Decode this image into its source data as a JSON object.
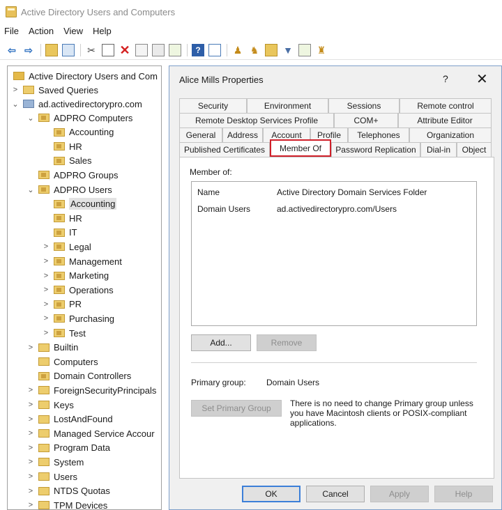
{
  "window": {
    "title": "Active Directory Users and Computers"
  },
  "menu": [
    "File",
    "Action",
    "View",
    "Help"
  ],
  "toolbar": {
    "icons": [
      "back-arrow-icon",
      "forward-arrow-icon",
      "up-folder-icon",
      "console-tree-icon",
      "cut-icon",
      "copy-icon",
      "delete-icon",
      "properties-icon",
      "refresh-icon",
      "export-list-icon",
      "help-icon",
      "mmc-icon",
      "create-user-icon",
      "create-group-icon",
      "create-ou-icon",
      "filter-icon",
      "find-icon",
      "add-to-group-icon"
    ]
  },
  "tree": {
    "root": "Active Directory Users and Com",
    "saved_queries": "Saved Queries",
    "domain": "ad.activedirectorypro.com",
    "nodes": [
      {
        "label": "ADPRO Computers",
        "level": 2,
        "expand": "open",
        "type": "ou"
      },
      {
        "label": "Accounting",
        "level": 3,
        "expand": "none",
        "type": "ou"
      },
      {
        "label": "HR",
        "level": 3,
        "expand": "none",
        "type": "ou"
      },
      {
        "label": "Sales",
        "level": 3,
        "expand": "none",
        "type": "ou"
      },
      {
        "label": "ADPRO Groups",
        "level": 2,
        "expand": "none",
        "type": "ou"
      },
      {
        "label": "ADPRO Users",
        "level": 2,
        "expand": "open",
        "type": "ou"
      },
      {
        "label": "Accounting",
        "level": 3,
        "expand": "none",
        "type": "ou",
        "selected": true
      },
      {
        "label": "HR",
        "level": 3,
        "expand": "none",
        "type": "ou"
      },
      {
        "label": "IT",
        "level": 3,
        "expand": "none",
        "type": "ou"
      },
      {
        "label": "Legal",
        "level": 3,
        "expand": "closed",
        "type": "ou"
      },
      {
        "label": "Management",
        "level": 3,
        "expand": "closed",
        "type": "ou"
      },
      {
        "label": "Marketing",
        "level": 3,
        "expand": "closed",
        "type": "ou"
      },
      {
        "label": "Operations",
        "level": 3,
        "expand": "closed",
        "type": "ou"
      },
      {
        "label": "PR",
        "level": 3,
        "expand": "closed",
        "type": "ou"
      },
      {
        "label": "Purchasing",
        "level": 3,
        "expand": "closed",
        "type": "ou"
      },
      {
        "label": "Test",
        "level": 3,
        "expand": "closed",
        "type": "ou"
      },
      {
        "label": "Builtin",
        "level": 2,
        "expand": "closed",
        "type": "folder"
      },
      {
        "label": "Computers",
        "level": 2,
        "expand": "none",
        "type": "folder"
      },
      {
        "label": "Domain Controllers",
        "level": 2,
        "expand": "none",
        "type": "ou"
      },
      {
        "label": "ForeignSecurityPrincipals",
        "level": 2,
        "expand": "closed",
        "type": "folder"
      },
      {
        "label": "Keys",
        "level": 2,
        "expand": "closed",
        "type": "folder"
      },
      {
        "label": "LostAndFound",
        "level": 2,
        "expand": "closed",
        "type": "folder"
      },
      {
        "label": "Managed Service Accour",
        "level": 2,
        "expand": "closed",
        "type": "folder"
      },
      {
        "label": "Program Data",
        "level": 2,
        "expand": "closed",
        "type": "folder"
      },
      {
        "label": "System",
        "level": 2,
        "expand": "closed",
        "type": "folder"
      },
      {
        "label": "Users",
        "level": 2,
        "expand": "closed",
        "type": "folder"
      },
      {
        "label": "NTDS Quotas",
        "level": 2,
        "expand": "closed",
        "type": "folder"
      },
      {
        "label": "TPM Devices",
        "level": 2,
        "expand": "closed",
        "type": "folder"
      }
    ]
  },
  "dialog": {
    "title": "Alice Mills Properties",
    "help": "?",
    "close": "✕",
    "tab_rows": [
      [
        "Security",
        "Environment",
        "Sessions",
        "Remote control"
      ],
      [
        "Remote Desktop Services Profile",
        "COM+",
        "Attribute Editor"
      ],
      [
        "General",
        "Address",
        "Account",
        "Profile",
        "Telephones",
        "Organization"
      ],
      [
        "Published Certificates",
        "Member Of",
        "Password Replication",
        "Dial-in",
        "Object"
      ]
    ],
    "active_tab": "Member Of",
    "member_of_label": "Member of:",
    "columns": [
      "Name",
      "Active Directory Domain Services Folder"
    ],
    "rows": [
      [
        "Domain Users",
        "ad.activedirectorypro.com/Users"
      ]
    ],
    "add_button": "Add...",
    "remove_button": "Remove",
    "primary_group_label": "Primary group:",
    "primary_group_value": "Domain Users",
    "set_primary_button": "Set Primary Group",
    "note": "There is no need to change Primary group unless you have Macintosh clients or POSIX-compliant applications.",
    "ok_button": "OK",
    "cancel_button": "Cancel",
    "apply_button": "Apply",
    "help_button": "Help"
  }
}
